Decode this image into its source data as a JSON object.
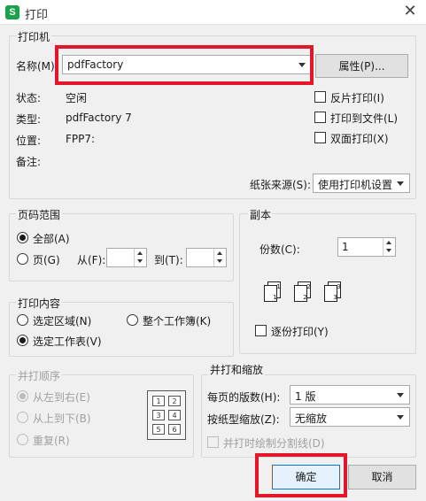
{
  "window": {
    "title": "打印",
    "app_icon_letter": "S"
  },
  "printer": {
    "group_label": "打印机",
    "name_label": "名称(M):",
    "name_value": "pdfFactory",
    "properties_button": "属性(P)...",
    "status_label": "状态:",
    "status_value": "空闲",
    "type_label": "类型:",
    "type_value": "pdfFactory 7",
    "location_label": "位置:",
    "location_value": "FPP7:",
    "comment_label": "备注:",
    "reverse_print": "反片打印(I)",
    "print_to_file": "打印到文件(L)",
    "duplex": "双面打印(X)",
    "paper_source_label": "纸张来源(S):",
    "paper_source_value": "使用打印机设置"
  },
  "page_range": {
    "group_label": "页码范围",
    "all": "全部(A)",
    "pages": "页(G)",
    "from": "从(F):",
    "to": "到(T):"
  },
  "copies": {
    "group_label": "副本",
    "count_label": "份数(C):",
    "count_value": "1",
    "collate": "逐份打印(Y)",
    "page_icons": [
      "1",
      "1",
      "2",
      "2",
      "3",
      "3"
    ]
  },
  "print_content": {
    "group_label": "打印内容",
    "selection": "选定区域(N)",
    "whole_workbook": "整个工作簿(K)",
    "selected_sheets": "选定工作表(V)"
  },
  "collate_order": {
    "group_label": "并打顺序",
    "left_to_right": "从左到右(E)",
    "top_to_bottom": "从上到下(B)",
    "repeat": "重复(R)",
    "grid_numbers": [
      "1",
      "2",
      "3",
      "4",
      "5",
      "6"
    ]
  },
  "scaling": {
    "group_label": "并打和缩放",
    "pages_per_sheet_label": "每页的版数(H):",
    "pages_per_sheet_value": "1 版",
    "scale_label": "按纸型缩放(Z):",
    "scale_value": "无缩放",
    "draw_dividers": "并打时绘制分割线(D)"
  },
  "buttons": {
    "ok": "确定",
    "cancel": "取消"
  },
  "colors": {
    "highlight": "#e3162a",
    "app_icon": "#1aa14a"
  }
}
